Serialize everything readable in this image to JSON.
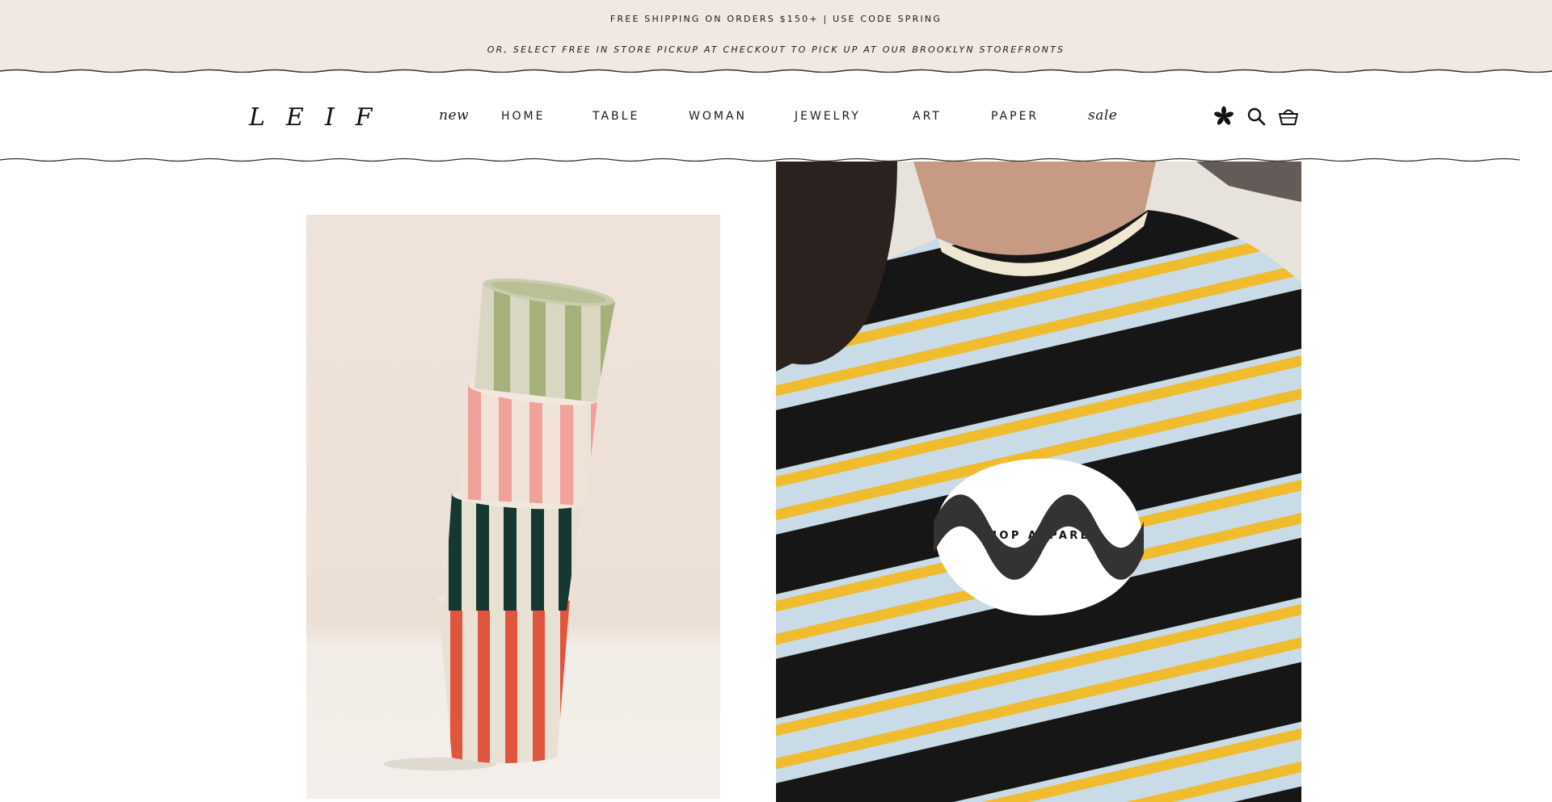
{
  "announcement": {
    "line1": "FREE SHIPPING ON ORDERS $150+ | USE CODE SPRING",
    "line2": "OR, SELECT FREE IN STORE PICKUP AT CHECKOUT TO PICK UP AT OUR BROOKLYN STOREFRONTS",
    "background": "#efe9e2"
  },
  "header": {
    "logo": "LEIF",
    "nav": [
      {
        "label": "new",
        "style": "script"
      },
      {
        "label": "HOME",
        "style": "caps"
      },
      {
        "label": "TABLE",
        "style": "caps"
      },
      {
        "label": "WOMAN",
        "style": "caps"
      },
      {
        "label": "JEWELRY",
        "style": "caps"
      },
      {
        "label": "ART",
        "style": "caps"
      },
      {
        "label": "PAPER",
        "style": "caps"
      },
      {
        "label": "sale",
        "style": "script"
      }
    ],
    "icons": [
      "flower-icon",
      "search-icon",
      "basket-icon"
    ]
  },
  "hero": {
    "left_image": "striped-ceramic-cups-stack",
    "right_image": "striped-tshirt-model",
    "cta_label": "SHOP APPAREL"
  }
}
